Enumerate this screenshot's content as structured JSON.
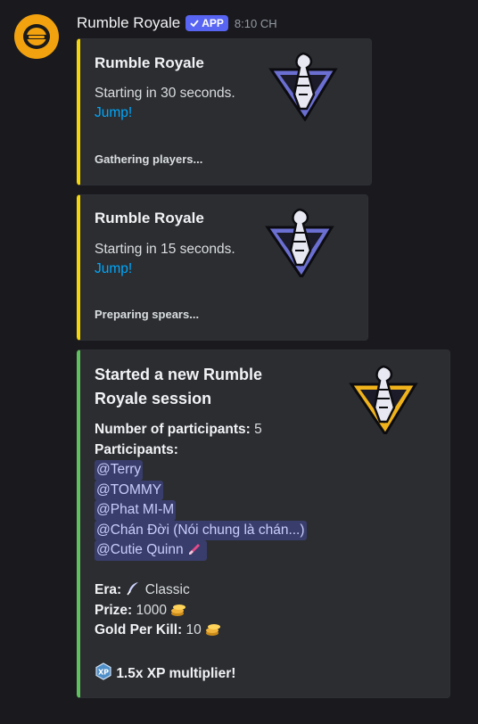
{
  "bot": {
    "name": "Rumble Royale",
    "badge": "APP",
    "time": "8:10 CH",
    "avatar_color": "#f2a20f"
  },
  "embeds": [
    {
      "title": "Rumble Royale",
      "text": "Starting in 30 seconds.",
      "link": "Jump!",
      "footer": "Gathering players..."
    },
    {
      "title": "Rumble Royale",
      "text": "Starting in 15 seconds.",
      "link": "Jump!",
      "footer": "Preparing spears..."
    }
  ],
  "session": {
    "title_line1": "Started a new Rumble",
    "title_line2": "Royale session",
    "participants_count_label": "Number of participants:",
    "participants_count": "5",
    "participants_label": "Participants:",
    "participants": [
      "@Terry",
      "@TOMMY",
      "@Phat MI-M",
      "@Chán Đời (Nói chung là chán...)",
      "@Cutie Quinn"
    ],
    "era_label": "Era:",
    "era_value": "Classic",
    "prize_label": "Prize:",
    "prize_value": "1000",
    "gold_label": "Gold Per Kill:",
    "gold_value": "10",
    "multiplier": "1.5x XP multiplier!"
  },
  "colors": {
    "accent_yellow": "#f5d60c",
    "accent_green": "#5fc05e",
    "link": "#00a8fc",
    "mention_bg": "#3b3f73"
  },
  "icons": [
    "rumble-logo-icon",
    "verified-check-icon",
    "paintbrush-icon",
    "feather-quill-icon",
    "coin-stack-icon",
    "xp-badge-icon"
  ]
}
